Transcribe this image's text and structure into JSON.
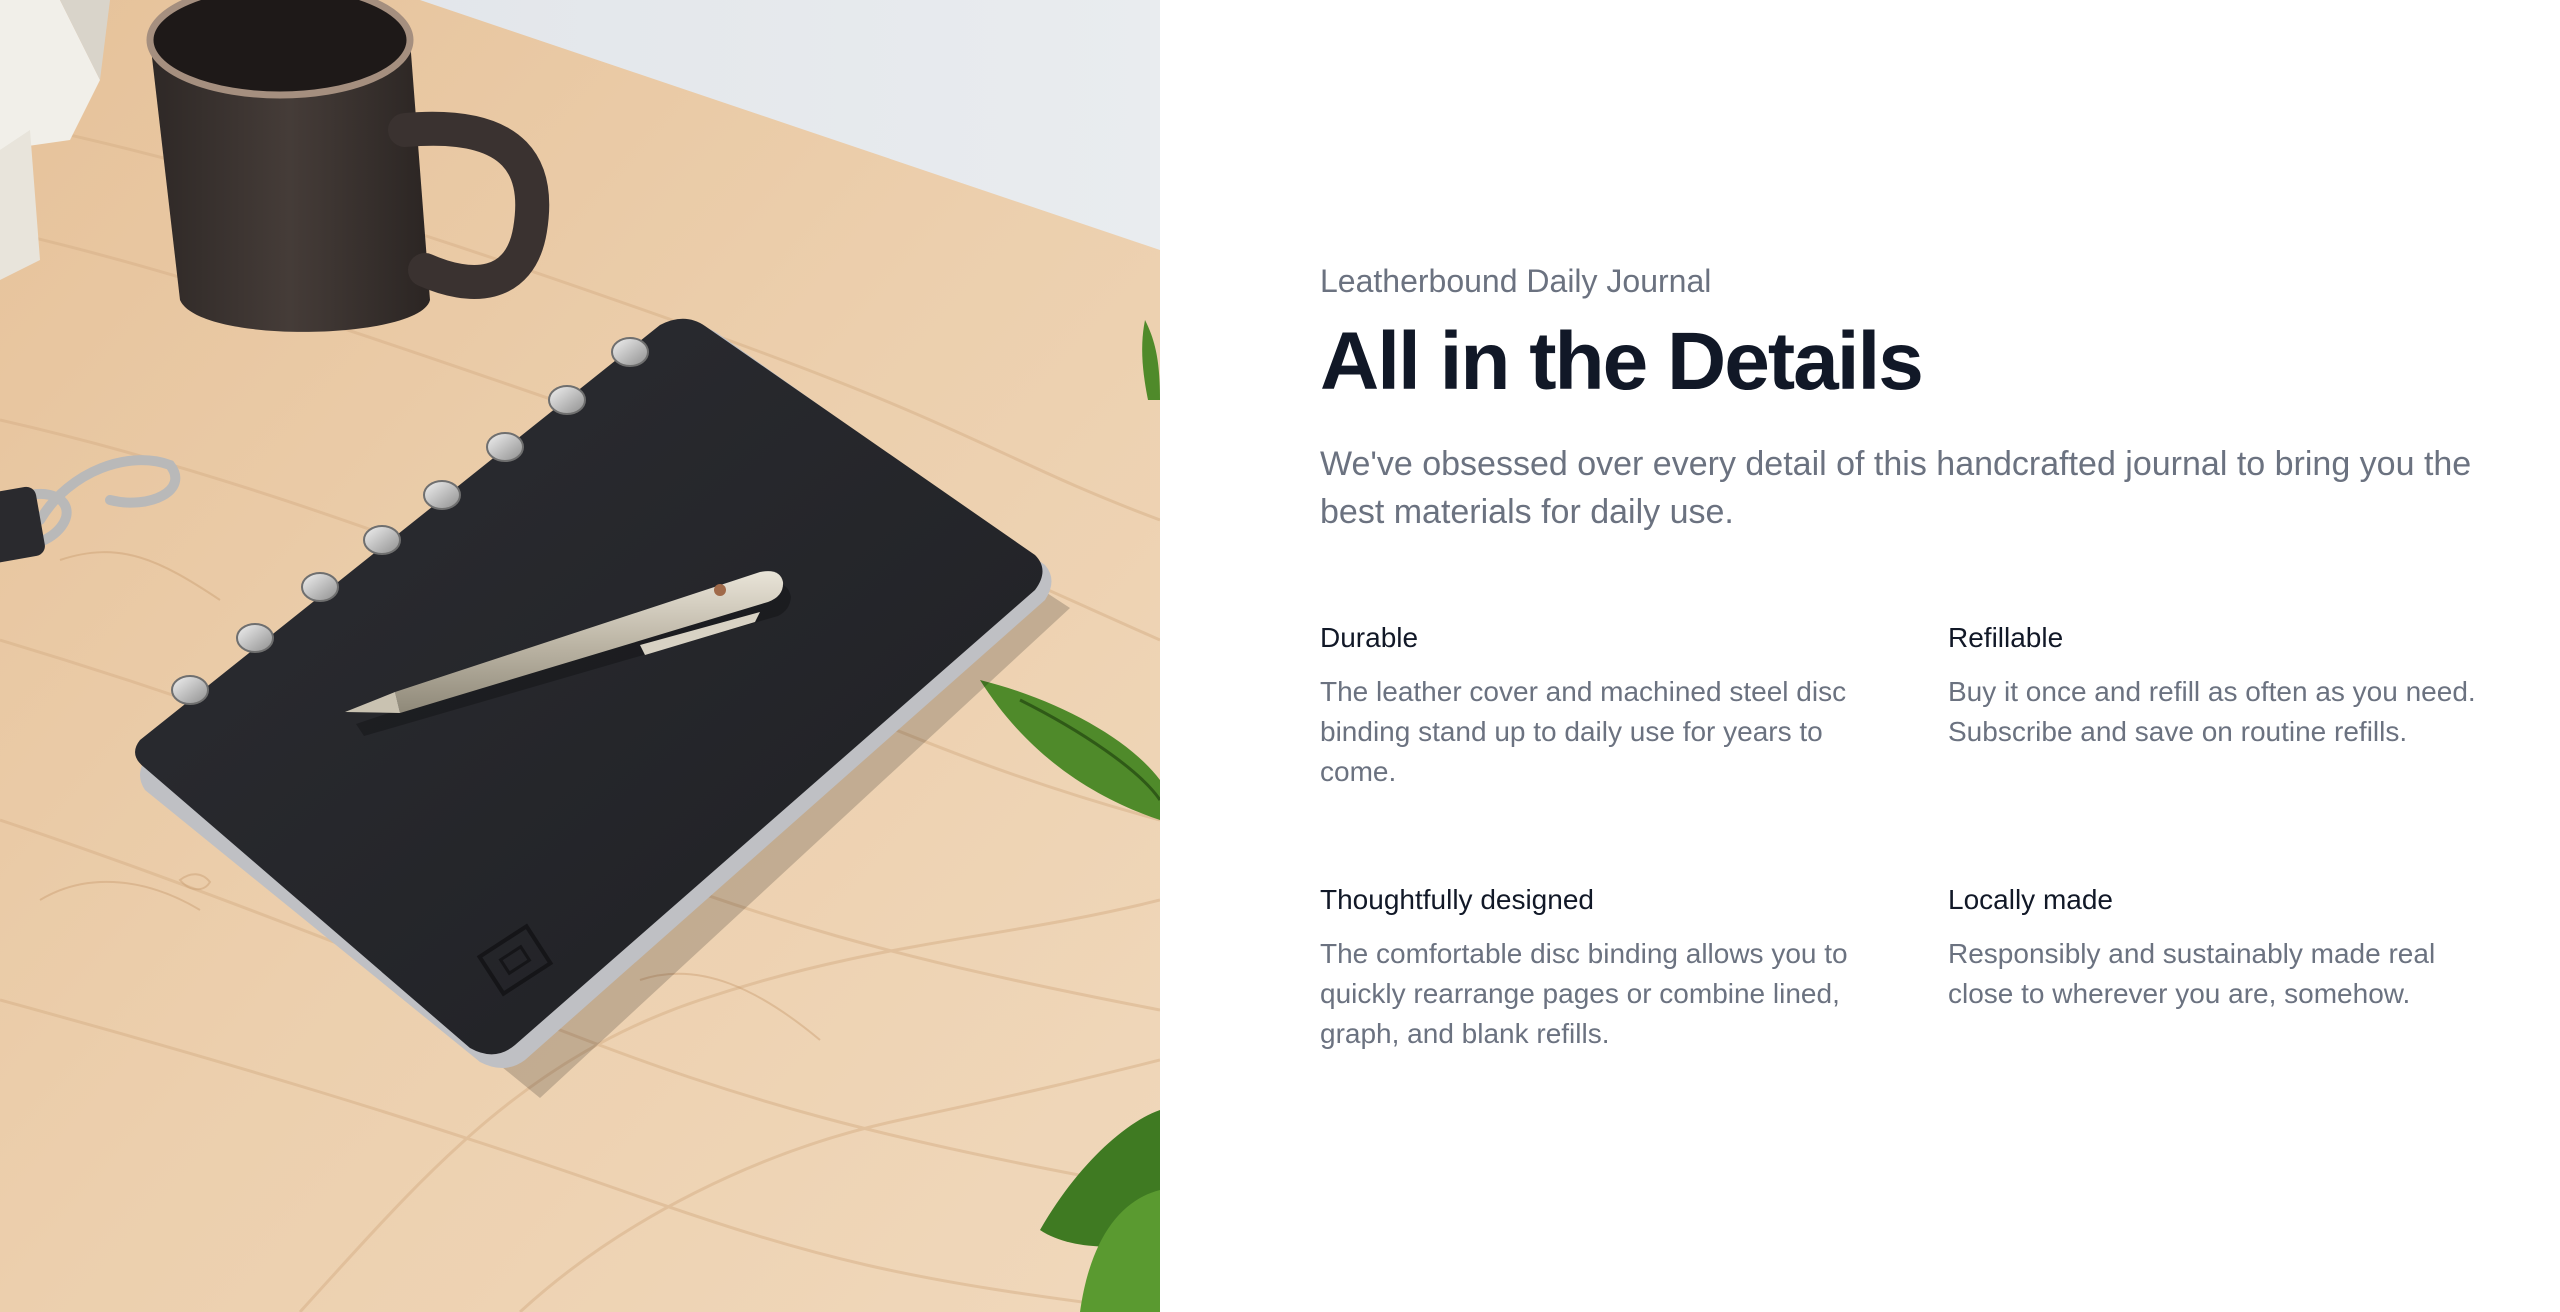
{
  "product": {
    "eyebrow": "Leatherbound Daily Journal",
    "heading": "All in the Details",
    "lead": "We've obsessed over every detail of this handcrafted journal to bring you the best materials for daily use."
  },
  "features": [
    {
      "title": "Durable",
      "description": "The leather cover and machined steel disc binding stand up to daily use for years to come."
    },
    {
      "title": "Refillable",
      "description": "Buy it once and refill as often as you need. Subscribe and save on routine refills."
    },
    {
      "title": "Thoughtfully designed",
      "description": "The comfortable disc binding allows you to quickly rearrange pages or combine lined, graph, and blank refills."
    },
    {
      "title": "Locally made",
      "description": "Responsibly and sustainably made real close to wherever you are, somehow."
    }
  ],
  "colors": {
    "heading": "#111827",
    "body_text": "#6b7280",
    "background": "#ffffff",
    "desk_wood": "#e8c9a4",
    "journal_cover": "#26272b",
    "mug": "#3b3533",
    "plant": "#4a7a28"
  },
  "image": {
    "alt_icon": "journal-photo"
  }
}
